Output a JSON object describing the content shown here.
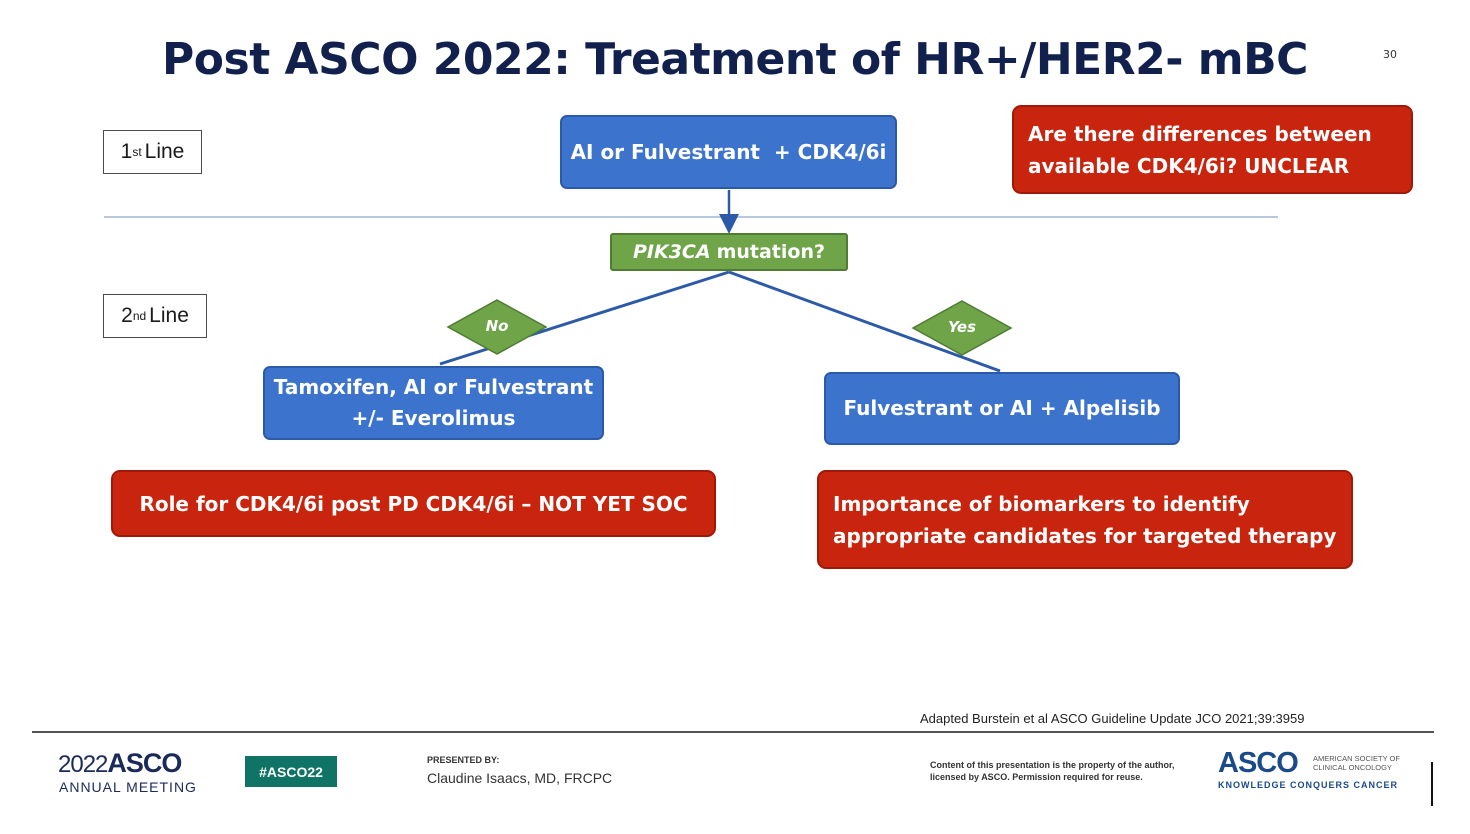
{
  "slide": {
    "title": "Post ASCO 2022: Treatment of HR+/HER2- mBC",
    "slide_number": "30"
  },
  "labels": {
    "first_line": {
      "num": "1",
      "sup": "st",
      "text": "Line"
    },
    "second_line": {
      "num": "2",
      "sup": "nd",
      "text": "Line"
    }
  },
  "nodes": {
    "first_line_treatment": "AI or Fulvestrant  + CDK4/6i",
    "question_italic": "PIK3CA",
    "question_rest": "mutation?",
    "no_label": "No",
    "yes_label": "Yes",
    "no_treatment_line1": "Tamoxifen, AI or Fulvestrant",
    "no_treatment_line2": "+/- Everolimus",
    "yes_treatment": "Fulvestrant or AI + Alpelisib"
  },
  "callouts": {
    "cdk_differences_line1": "Are there differences between",
    "cdk_differences_line2": "available CDK4/6i?  UNCLEAR",
    "cdk_post_pd": "Role for CDK4/6i post PD CDK4/6i – NOT YET SOC",
    "biomarkers_line1": "Importance of biomarkers to identify",
    "biomarkers_line2": "appropriate candidates for targeted therapy"
  },
  "footer": {
    "citation": "Adapted Burstein et al ASCO Guideline Update JCO 2021;39:3959",
    "meeting_year": "2022",
    "meeting_name": "ASCO",
    "annual_meeting": "ANNUAL MEETING",
    "hashtag": "#ASCO22",
    "presented_by_label": "PRESENTED BY:",
    "presenter": "Claudine Isaacs, MD, FRCPC",
    "content_note": "Content of this presentation is the property of the author, licensed by ASCO. Permission required for reuse.",
    "asco_logo": "ASCO",
    "asco_society": "AMERICAN SOCIETY OF CLINICAL ONCOLOGY",
    "asco_tagline": "KNOWLEDGE CONQUERS CANCER"
  },
  "colors": {
    "title": "#12204e",
    "blue_node": "#3c73cd",
    "red_callout": "#c8240e",
    "green_decision": "#6fa449",
    "hashtag_bg": "#0f7465"
  }
}
